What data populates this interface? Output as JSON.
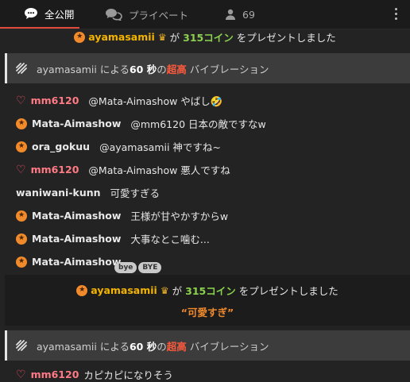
{
  "tabs": {
    "public_label": "全公開",
    "private_label": "プライベート",
    "viewer_count": "69"
  },
  "gift1": {
    "user": "ayamasamii",
    "pre": "が",
    "coins": "315コイン",
    "post": "をプレゼントしました"
  },
  "vibration1": {
    "user": "ayamasamii",
    "by": "による",
    "seconds": "60 秒",
    "of": "の",
    "level": "超高",
    "label": "バイブレーション"
  },
  "messages": [
    {
      "name": "mm6120",
      "text": "@Mata-Aimashow やばし🤣",
      "badge": "heart"
    },
    {
      "name": "Mata-Aimashow",
      "text": "@mm6120 日本の敵ですなw",
      "badge": "star"
    },
    {
      "name": "ora_gokuu",
      "text": "@ayamasamii 神ですね~",
      "badge": "star"
    },
    {
      "name": "mm6120",
      "text": "@Mata-Aimashow 悪人ですね",
      "badge": "heart"
    },
    {
      "name": "waniwani-kunn",
      "text": "可愛すぎる",
      "badge": "none"
    },
    {
      "name": "Mata-Aimashow",
      "text": "王様が甘やかすからw",
      "badge": "star"
    },
    {
      "name": "Mata-Aimashow",
      "text": "大事なとこ噛む...",
      "badge": "star"
    },
    {
      "name": "Mata-Aimashow",
      "text": "",
      "badge": "star"
    }
  ],
  "gift2": {
    "user": "ayamasamii",
    "pre": "が",
    "coins": "315コイン",
    "post": "をプレゼントしました",
    "message": "“可愛すぎ”"
  },
  "vibration2": {
    "user": "ayamasamii",
    "by": "による",
    "seconds": "60 秒",
    "of": "の",
    "level": "超高",
    "label": "バイブレーション"
  },
  "last_message": {
    "name": "mm6120",
    "text": "カピカピになりそう",
    "badge": "heart"
  },
  "sticker": {
    "a": "bye",
    "b": "BYE"
  }
}
